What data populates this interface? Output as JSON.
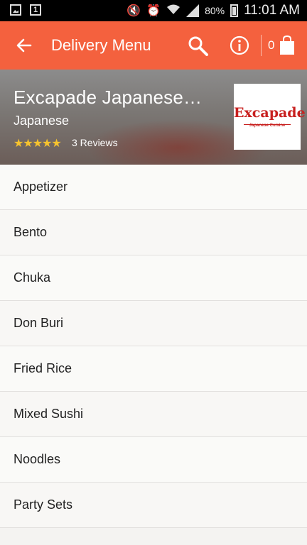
{
  "status_bar": {
    "battery": "80%",
    "time": "11:01 AM",
    "sim_label": "1"
  },
  "app_bar": {
    "title": "Delivery Menu",
    "cart_count": "0"
  },
  "restaurant": {
    "name": "Excapade Japanese…",
    "cuisine": "Japanese",
    "rating_stars": "★★★★★",
    "rating_value": 5,
    "reviews": "3 Reviews",
    "logo_text": "Excapade",
    "logo_subtext": "Japanese Cuisine"
  },
  "menu": {
    "categories": [
      {
        "label": "Appetizer"
      },
      {
        "label": "Bento"
      },
      {
        "label": "Chuka"
      },
      {
        "label": "Don Buri"
      },
      {
        "label": "Fried Rice"
      },
      {
        "label": "Mixed Sushi"
      },
      {
        "label": "Noodles"
      },
      {
        "label": "Party Sets"
      }
    ]
  },
  "colors": {
    "accent": "#f4613e",
    "star": "#f7c32e",
    "logo_red": "#c8201f"
  }
}
